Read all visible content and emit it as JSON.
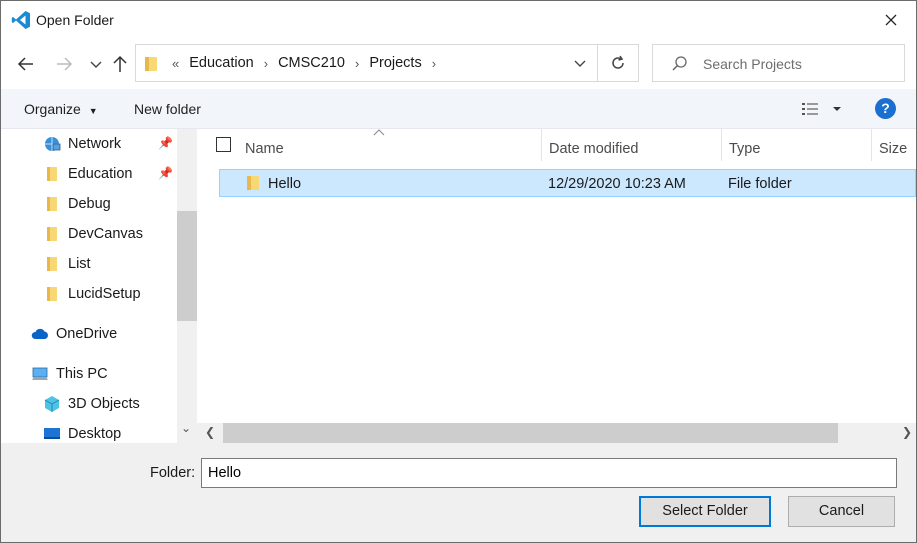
{
  "window": {
    "title": "Open Folder",
    "close_icon": "close-icon",
    "app_icon": "vscode-icon"
  },
  "nav": {
    "back_icon": "arrow-left-icon",
    "forward_icon": "arrow-right-icon",
    "recent_icon": "chevron-down-icon",
    "up_icon": "arrow-up-icon"
  },
  "address": {
    "overflow": "«",
    "crumbs": [
      "Education",
      "CMSC210",
      "Projects"
    ]
  },
  "search": {
    "placeholder": "Search Projects"
  },
  "toolbar": {
    "organize": "Organize",
    "new_folder": "New folder",
    "help": "?"
  },
  "sidebar": {
    "items": [
      {
        "label": "Network",
        "icon": "network-icon",
        "pinned": true
      },
      {
        "label": "Education",
        "icon": "folder-icon",
        "pinned": true
      },
      {
        "label": "Debug",
        "icon": "folder-icon"
      },
      {
        "label": "DevCanvas",
        "icon": "folder-icon"
      },
      {
        "label": "List",
        "icon": "folder-icon"
      },
      {
        "label": "LucidSetup",
        "icon": "folder-icon"
      },
      {
        "label": "OneDrive",
        "icon": "cloud-icon"
      },
      {
        "label": "This PC",
        "icon": "computer-icon"
      },
      {
        "label": "3D Objects",
        "icon": "cube-icon"
      },
      {
        "label": "Desktop",
        "icon": "desktop-icon"
      }
    ]
  },
  "files": {
    "columns": [
      "Name",
      "Date modified",
      "Type",
      "Size"
    ],
    "rows": [
      {
        "name": "Hello",
        "date": "12/29/2020 10:23 AM",
        "type": "File folder"
      }
    ]
  },
  "footer": {
    "folder_label": "Folder:",
    "folder_value": "Hello",
    "select_button": "Select Folder",
    "cancel_button": "Cancel"
  },
  "colors": {
    "accent": "#0078d7",
    "selection": "#cce8ff",
    "folder": "#f8d775"
  }
}
